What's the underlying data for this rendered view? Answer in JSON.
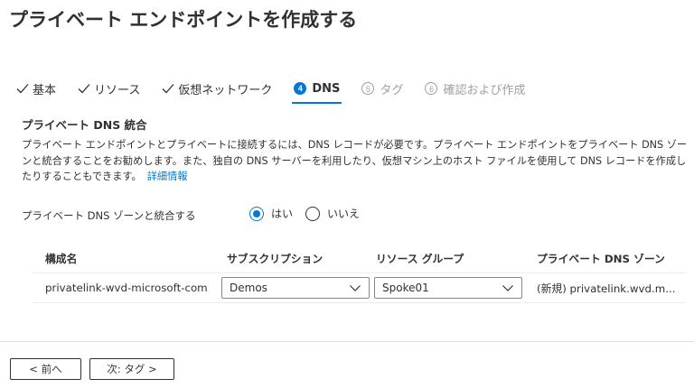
{
  "header": {
    "title": "プライベート エンドポイントを作成する",
    "more": "…"
  },
  "tabs": [
    {
      "label": "基本",
      "state": "done"
    },
    {
      "label": "リソース",
      "state": "done"
    },
    {
      "label": "仮想ネットワーク",
      "state": "done"
    },
    {
      "label": "DNS",
      "state": "active",
      "step": "4"
    },
    {
      "label": "タグ",
      "state": "disabled",
      "step": "5"
    },
    {
      "label": "確認および作成",
      "state": "disabled",
      "step": "6"
    }
  ],
  "section": {
    "title": "プライベート DNS 統合",
    "description": "プライベート エンドポイントとプライベートに接続するには、DNS レコードが必要です。プライベート エンドポイントをプライベート DNS ゾーンと統合することをお勧めします。また、独自の DNS サーバーを利用したり、仮想マシン上のホスト ファイルを使用して DNS レコードを作成したりすることもできます。",
    "link": "詳細情報"
  },
  "integration": {
    "label": "プライベート DNS ゾーンと統合する",
    "yes": "はい",
    "no": "いいえ",
    "selected": "yes"
  },
  "table": {
    "headers": [
      "構成名",
      "サブスクリプション",
      "リソース グループ",
      "プライベート DNS ゾーン"
    ],
    "rows": [
      {
        "config": "privatelink-wvd-microsoft-com",
        "subscription": "Demos",
        "resource_group": "Spoke01",
        "zone": "(新規) privatelink.wvd.m..."
      }
    ]
  },
  "footer": {
    "prev": "< 前へ",
    "next": "次: タグ >"
  },
  "colors": {
    "accent": "#0078d4",
    "text": "#323130",
    "disabled": "#a19f9d"
  }
}
